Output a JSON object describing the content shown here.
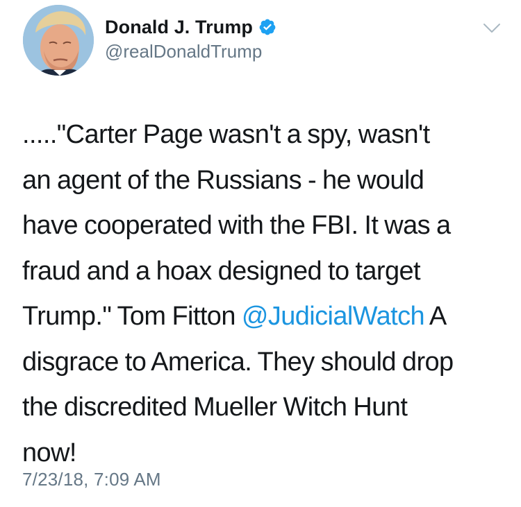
{
  "author": {
    "display_name": "Donald J. Trump",
    "handle": "@realDonaldTrump",
    "verified": true,
    "avatar_icon": "profile-photo"
  },
  "menu": {
    "icon": "chevron-down-icon"
  },
  "tweet": {
    "lines": [
      {
        "parts": [
          {
            "text": ".....\"Carter Page wasn't a spy, wasn't"
          }
        ]
      },
      {
        "parts": [
          {
            "text": "an agent of the Russians - he would"
          }
        ]
      },
      {
        "parts": [
          {
            "text": "have cooperated with the FBI. It was a"
          }
        ]
      },
      {
        "parts": [
          {
            "text": "fraud and a hoax designed to target"
          }
        ]
      },
      {
        "parts": [
          {
            "text": "Trump.\" Tom Fitton "
          },
          {
            "text": "@JudicialWatch",
            "mention": true
          },
          {
            "text": " A"
          }
        ]
      },
      {
        "parts": [
          {
            "text": "disgrace to America. They should drop"
          }
        ]
      },
      {
        "parts": [
          {
            "text": "the discredited Mueller Witch Hunt"
          }
        ]
      },
      {
        "parts": [
          {
            "text": "now!"
          }
        ]
      }
    ],
    "timestamp": "7/23/18, 7:09 AM"
  },
  "colors": {
    "text": "#14171a",
    "secondary": "#657786",
    "link": "#1b95e0",
    "verified_badge": "#1da1f2"
  }
}
